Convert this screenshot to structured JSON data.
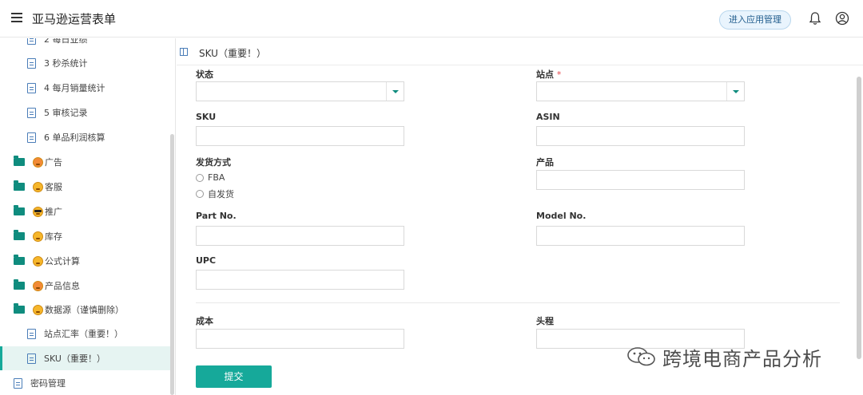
{
  "header": {
    "title": "亚马逊运营表单",
    "manage_label": "进入应用管理"
  },
  "sidebar": {
    "items": [
      {
        "label": "2 每日业绩",
        "icon": "doc-icon"
      },
      {
        "label": "3 秒杀统计",
        "icon": "doc-icon"
      },
      {
        "label": "4 每月销量统计",
        "icon": "doc-icon"
      },
      {
        "label": "5 审核记录",
        "icon": "doc-icon"
      },
      {
        "label": "6 单品利润核算",
        "icon": "doc-icon"
      },
      {
        "label": "广告",
        "icon": "folder-icon"
      },
      {
        "label": "客服",
        "icon": "folder-icon"
      },
      {
        "label": "推广",
        "icon": "folder-icon"
      },
      {
        "label": "库存",
        "icon": "folder-icon"
      },
      {
        "label": "公式计算",
        "icon": "folder-icon"
      },
      {
        "label": "产品信息",
        "icon": "folder-icon"
      },
      {
        "label": "数据源（谨慎删除）",
        "icon": "folder-icon"
      },
      {
        "label": "站点汇率（重要！）",
        "icon": "doc-icon"
      },
      {
        "label": "SKU（重要！）",
        "icon": "doc-icon",
        "active": true
      },
      {
        "label": "密码管理",
        "icon": "doc-icon"
      }
    ]
  },
  "form": {
    "title": "SKU（重要！）",
    "fields": {
      "status": {
        "label": "状态"
      },
      "site": {
        "label": "站点",
        "required_mark": "*"
      },
      "sku": {
        "label": "SKU"
      },
      "asin": {
        "label": "ASIN"
      },
      "shipping": {
        "label": "发货方式",
        "options": [
          "FBA",
          "自发货"
        ]
      },
      "product": {
        "label": "产品"
      },
      "part_no": {
        "label": "Part No."
      },
      "model_no": {
        "label": "Model No."
      },
      "upc": {
        "label": "UPC"
      },
      "cost": {
        "label": "成本"
      },
      "first_leg": {
        "label": "头程"
      }
    },
    "submit_label": "提交"
  },
  "watermark": {
    "text": "跨境电商产品分析"
  },
  "colors": {
    "accent": "#16a99a",
    "folder": "#0f8c7e",
    "doc_icon": "#4a7db8",
    "required": "#e5484d"
  }
}
